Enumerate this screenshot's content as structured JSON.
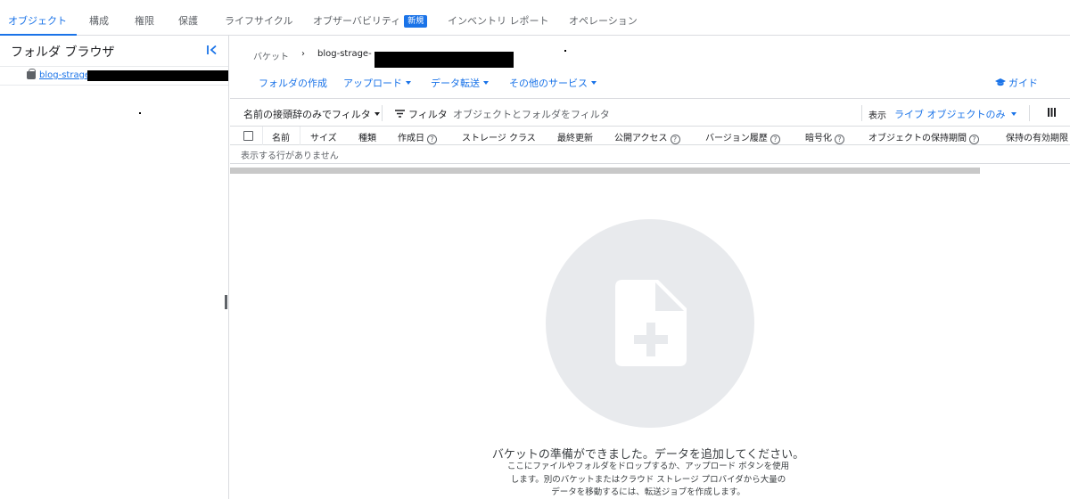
{
  "tabs": {
    "objects": "オブジェクト",
    "config": "構成",
    "permissions": "権限",
    "protection": "保護",
    "lifecycle": "ライフサイクル",
    "observability": "オブザーバビリティ",
    "observability_badge": "新規",
    "inventory_reports": "インベントリ レポート",
    "operations": "オペレーション"
  },
  "sidebar": {
    "title": "フォルダ ブラウザ",
    "collapse_icon": "collapse-left-icon",
    "bucket_icon": "bucket-icon",
    "bucket_name": "blog-strage-"
  },
  "breadcrumb": {
    "root": "バケット",
    "separator": "›",
    "bucket": "blog-strage-"
  },
  "actions": {
    "create_folder": "フォルダの作成",
    "upload": "アップロード",
    "transfer": "データ転送",
    "other_services": "その他のサービス",
    "guide": "ガイド"
  },
  "filter": {
    "prefix_filter": "名前の接頭辞のみでフィルタ",
    "filter_label": "フィルタ",
    "placeholder": "オブジェクトとフォルダをフィルタ",
    "view_label": "表示",
    "view_value": "ライブ オブジェクトのみ"
  },
  "table": {
    "columns": [
      "名前",
      "サイズ",
      "種類",
      "作成日",
      "ストレージ クラス",
      "最終更新",
      "公開アクセス",
      "バージョン履歴",
      "暗号化",
      "オブジェクトの保持期間",
      "保持の有効期限"
    ],
    "empty_message": "表示する行がありません"
  },
  "empty_state": {
    "icon": "add-file-icon",
    "title": "バケットの準備ができました。データを追加してください。",
    "desc_line1": "ここにファイルやフォルダをドロップするか、アップロード ボタンを使用",
    "desc_line2": "します。別のバケットまたはクラウド ストレージ プロバイダから大量の",
    "desc_line3": "データを移動するには、転送ジョブを作成します。"
  },
  "colors": {
    "accent": "#1a73e8",
    "text": "#202124",
    "muted": "#5f6368",
    "border": "#dadce0",
    "empty_circle": "#e8eaed"
  }
}
